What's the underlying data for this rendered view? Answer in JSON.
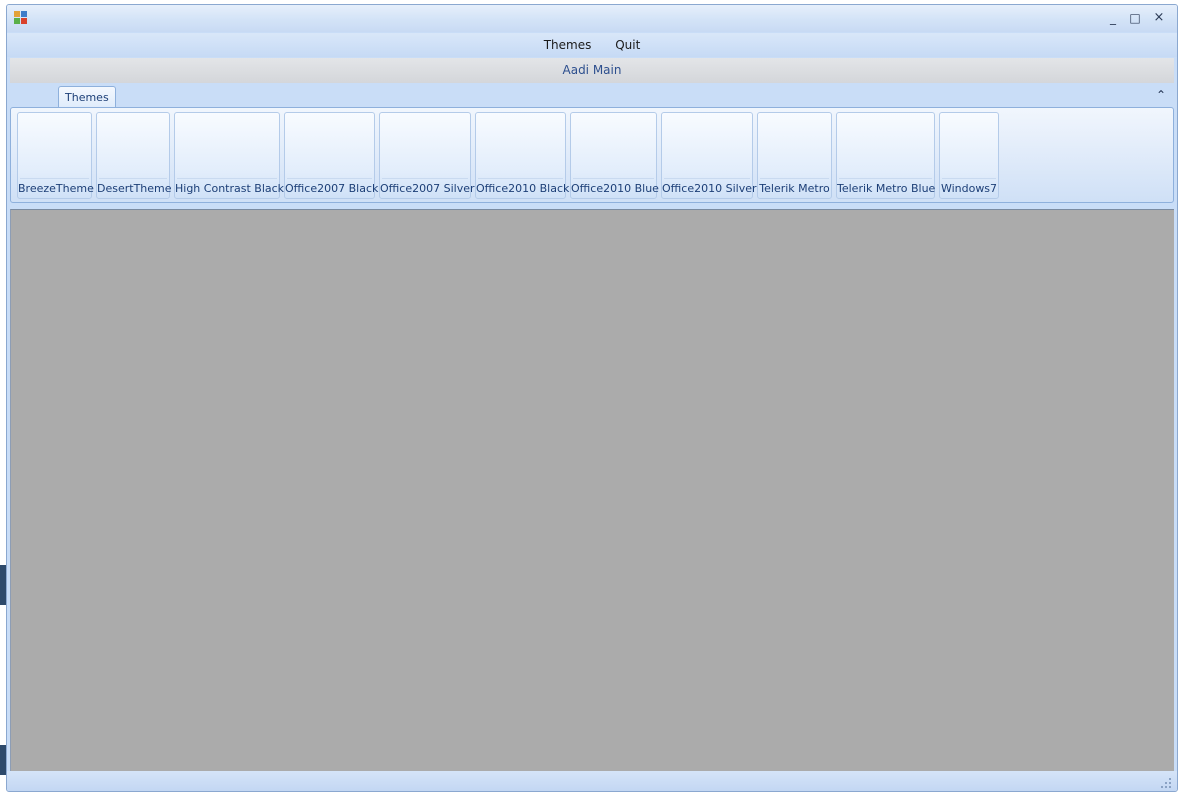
{
  "window": {
    "title": "",
    "controls": {
      "minimize": "_",
      "maximize": "□",
      "close": "×"
    }
  },
  "menu": {
    "items": [
      "Themes",
      "Quit"
    ]
  },
  "caption": "Aadi Main",
  "tabs": [
    {
      "label": "Themes",
      "selected": true
    }
  ],
  "ribbon": {
    "collapse_icon": "chevron-up-icon",
    "themes": [
      "BreezeTheme",
      "DesertTheme",
      "High Contrast Black",
      "Office2007 Black",
      "Office2007 Silver",
      "Office2010 Black",
      "Office2010 Blue",
      "Office2010 Silver",
      "Telerik Metro",
      "Telerik Metro Blue",
      "Windows7"
    ]
  },
  "colors": {
    "window_frame": "#c9ddf7",
    "content_background": "#ababab",
    "accent_text": "#1d3f77"
  }
}
